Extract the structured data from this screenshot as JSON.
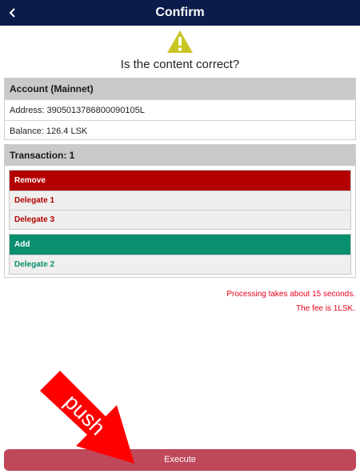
{
  "header": {
    "title": "Confirm"
  },
  "prompt": {
    "question": "Is the content correct?"
  },
  "account": {
    "heading": "Account (Mainnet)",
    "address": "Address: 3905013786800090105L",
    "balance": "Balance: 126.4 LSK"
  },
  "transaction": {
    "heading": "Transaction: 1",
    "remove": {
      "label": "Remove",
      "items": [
        "Delegate 1",
        "Delegate 3"
      ]
    },
    "add": {
      "label": "Add",
      "items": [
        "Delegate 2"
      ]
    }
  },
  "notes": {
    "processing": "Processing takes about 15 seconds.",
    "fee": "The fee is 1LSK."
  },
  "execute_label": "Execute",
  "annotation": {
    "text": "push"
  },
  "colors": {
    "header": "#0b1b4a",
    "warning": "#c9c624",
    "remove": "#b30000",
    "add": "#0a8f6f",
    "note": "#e8001c",
    "execute": "#c0485b",
    "annotation_arrow": "#ff0000"
  },
  "icons": {
    "back": "chevron-left-icon",
    "warning": "warning-triangle-icon"
  }
}
